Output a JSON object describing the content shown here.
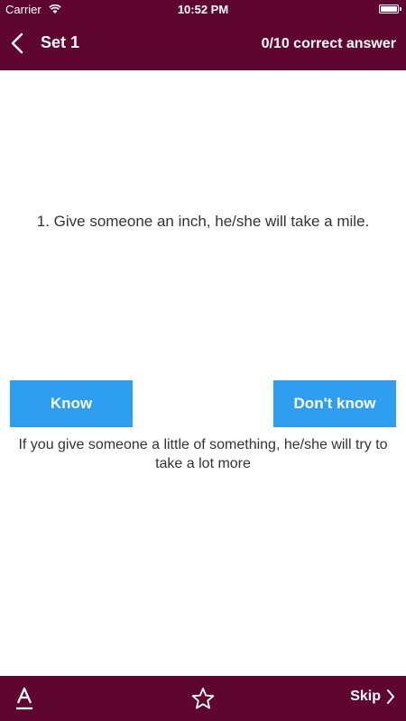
{
  "status_bar": {
    "carrier": "Carrier",
    "time": "10:52 PM",
    "wifi_icon": "wifi-icon",
    "battery_icon": "battery-icon",
    "battery_level": 1.0
  },
  "nav": {
    "back_icon": "chevron-left-icon",
    "title": "Set 1",
    "score": "0/10 correct answer"
  },
  "card": {
    "question": "1. Give someone an inch, he/she will take a mile.",
    "meaning": "If you give someone a little of something, he/she will try to take a lot more"
  },
  "actions": {
    "know_label": "Know",
    "dont_know_label": "Don't know"
  },
  "toolbar": {
    "font_icon": "font-size-icon",
    "star_icon": "star-icon",
    "skip_label": "Skip",
    "skip_icon": "chevron-right-icon"
  },
  "colors": {
    "bar": "#5f0630",
    "button": "#2e9ef0",
    "text": "#333333"
  }
}
